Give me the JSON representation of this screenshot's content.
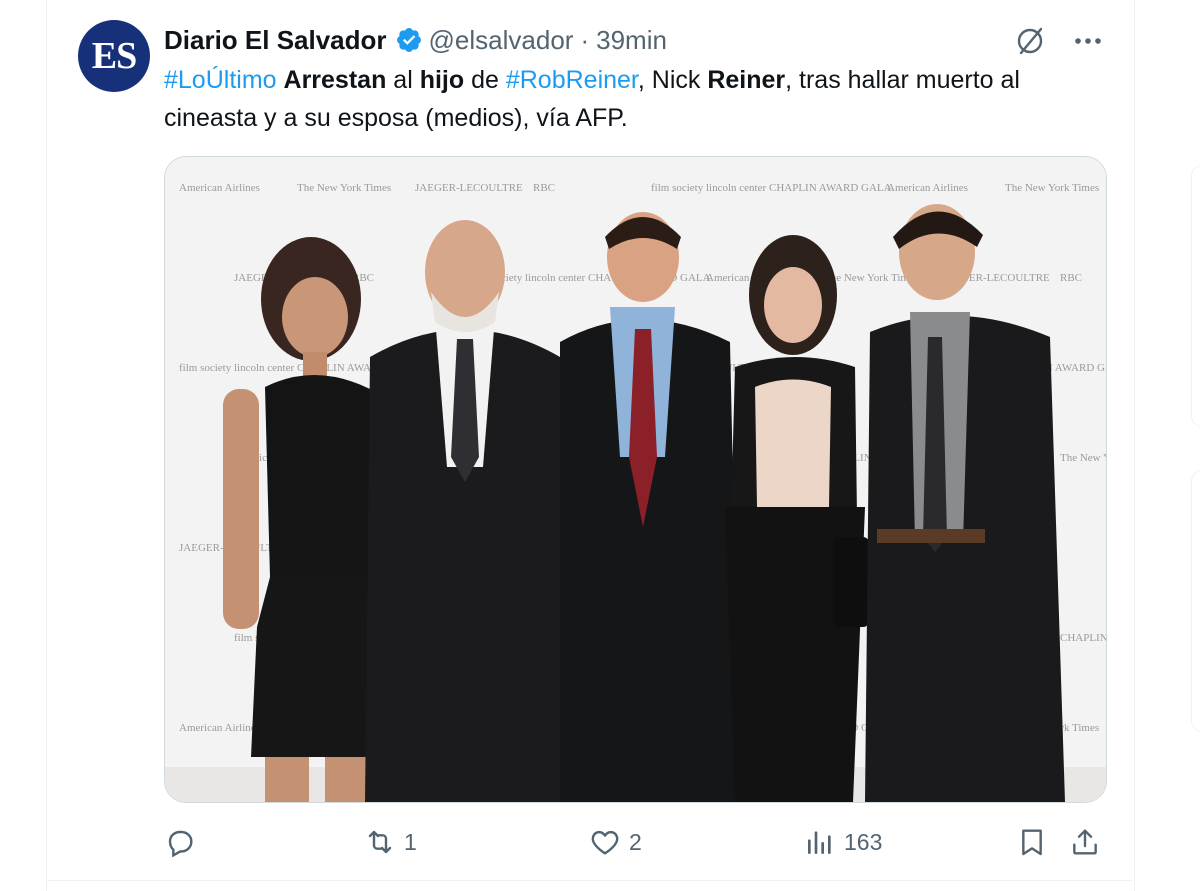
{
  "author": {
    "avatar_text": "ES",
    "display_name": "Diario El Salvador",
    "handle": "@elsalvador",
    "separator": "·",
    "time": "39min",
    "verified_color": "#1d9bf0",
    "avatar_color": "#17307a"
  },
  "tweet": {
    "segments": [
      {
        "text": "#LoÚltimo",
        "style": "hashtag"
      },
      {
        "text": " ",
        "style": "plain"
      },
      {
        "text": "Arrestan",
        "style": "bold"
      },
      {
        "text": " al ",
        "style": "plain"
      },
      {
        "text": "hijo",
        "style": "bold"
      },
      {
        "text": " de ",
        "style": "plain"
      },
      {
        "text": "#RobReiner",
        "style": "hashtag"
      },
      {
        "text": ", Nick ",
        "style": "plain"
      },
      {
        "text": "Reiner",
        "style": "bold"
      },
      {
        "text": ", tras hallar muerto al cineasta y a su esposa (medios), vía AFP.",
        "style": "plain"
      }
    ]
  },
  "media": {
    "backdrop_logos": [
      "American Airlines",
      "The New York Times",
      "JAEGER-LECOULTRE",
      "RBC",
      "film society lincoln center",
      "CHAPLIN AWARD GALA"
    ]
  },
  "actions": {
    "reply_count": "",
    "retweet_count": "1",
    "like_count": "2",
    "views_count": "163"
  },
  "icons": {
    "grok": "grok-icon",
    "more": "more-icon",
    "reply": "reply-icon",
    "retweet": "retweet-icon",
    "like": "heart-icon",
    "views": "analytics-icon",
    "bookmark": "bookmark-icon",
    "share": "share-icon"
  },
  "colors": {
    "accent": "#1d9bf0",
    "muted": "#536471",
    "text": "#0f1419"
  }
}
